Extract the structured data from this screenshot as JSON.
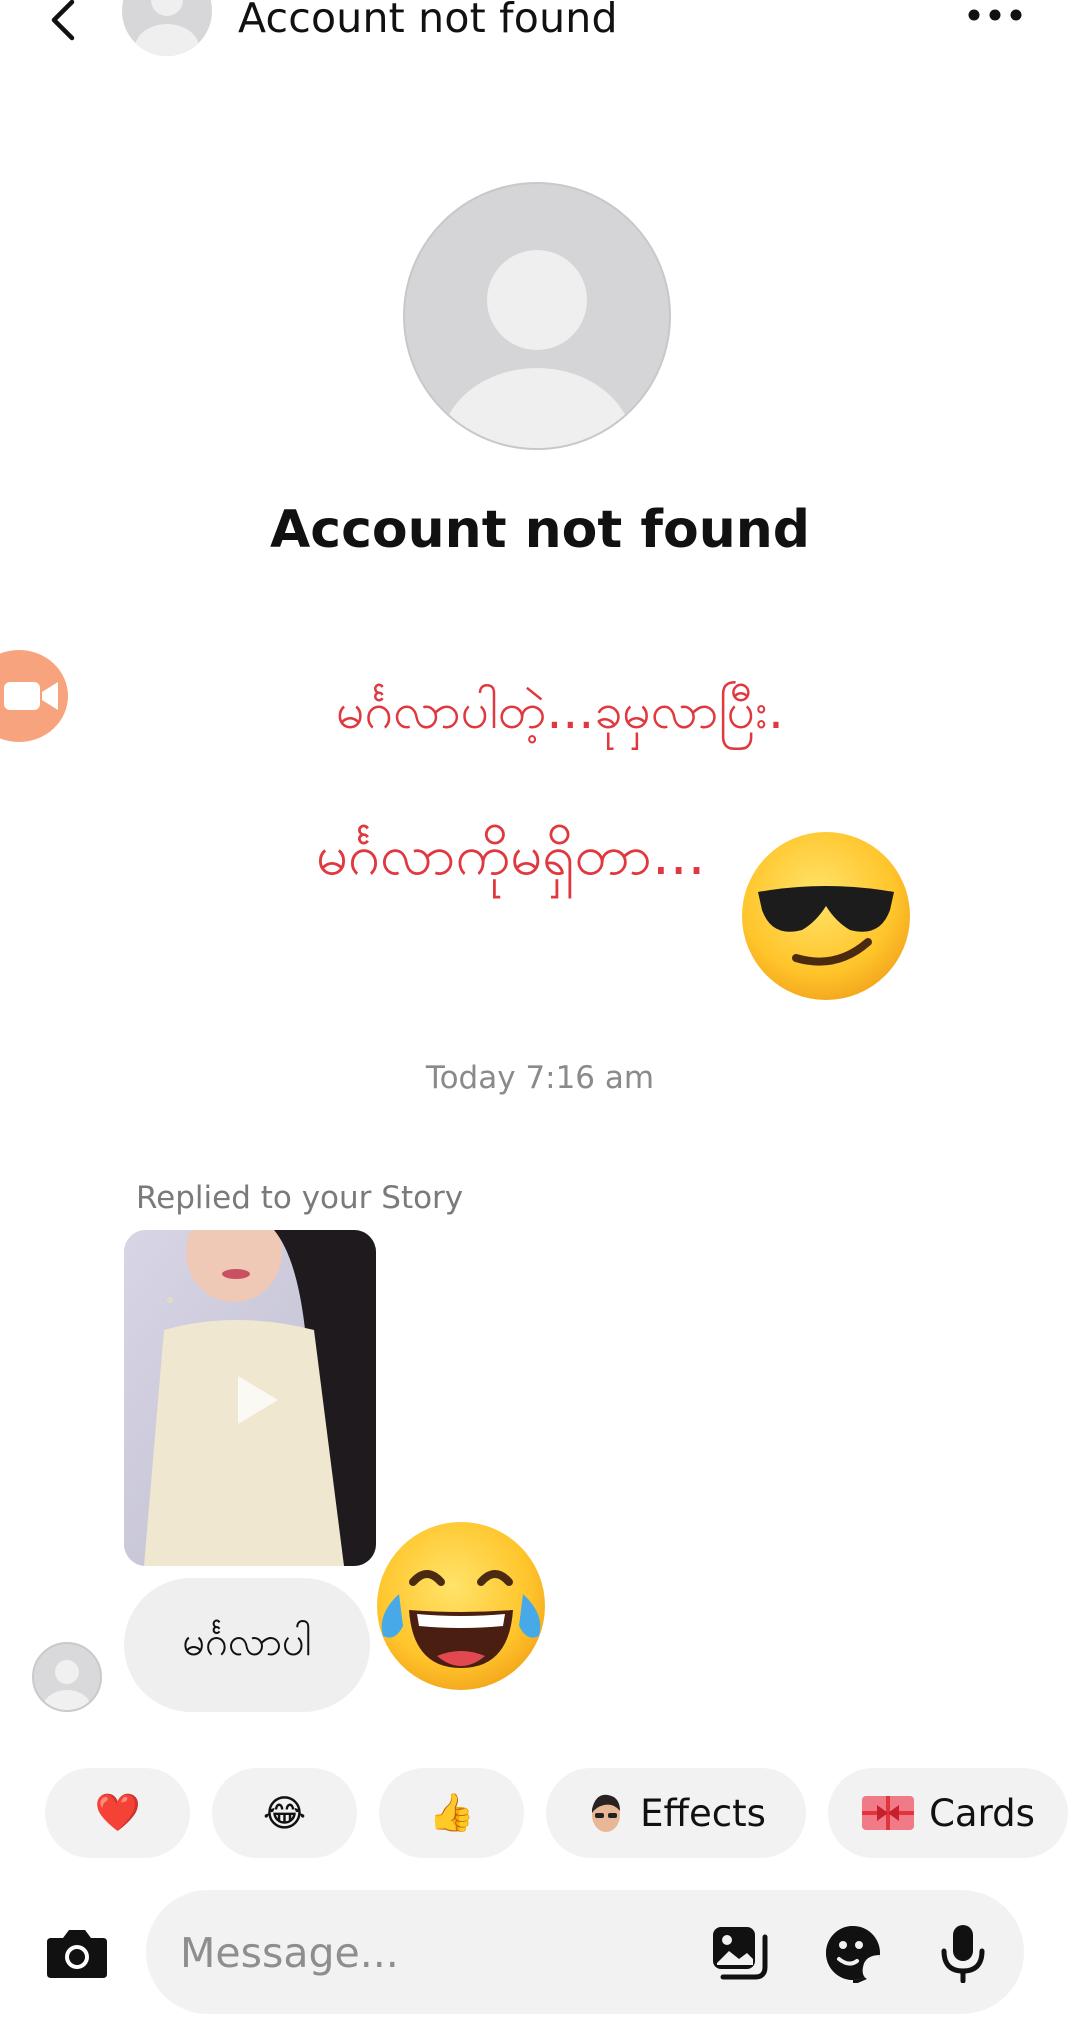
{
  "header": {
    "title": "Account not found",
    "back_icon": "chevron-left-icon",
    "more_icon": "more-horizontal-icon"
  },
  "profile": {
    "name": "Account not found"
  },
  "overlay": {
    "line1": "မင်္ဂလာပါတဲ့...ခုမှလာပြီး.",
    "line2": "မင်္ဂလာကိုမရှိတာ...",
    "emoji_name": "smirking-sunglasses-emoji",
    "color": "#e0383f"
  },
  "chat": {
    "timestamp": "Today 7:16 am",
    "replied_label": "Replied to your Story",
    "message_text": "မင်္ဂလာပါ",
    "reaction_emoji": "tears-of-joy-emoji"
  },
  "quick_actions": {
    "heart": "❤️",
    "joy": "😂",
    "thumbs": "👍",
    "effects_label": "Effects",
    "cards_label": "Cards"
  },
  "composer": {
    "placeholder": "Message...",
    "icons": [
      "camera-icon",
      "gallery-icon",
      "sticker-icon",
      "microphone-icon"
    ]
  },
  "colors": {
    "video_call": "#f7a37e",
    "bubble_bg": "#efefef"
  }
}
